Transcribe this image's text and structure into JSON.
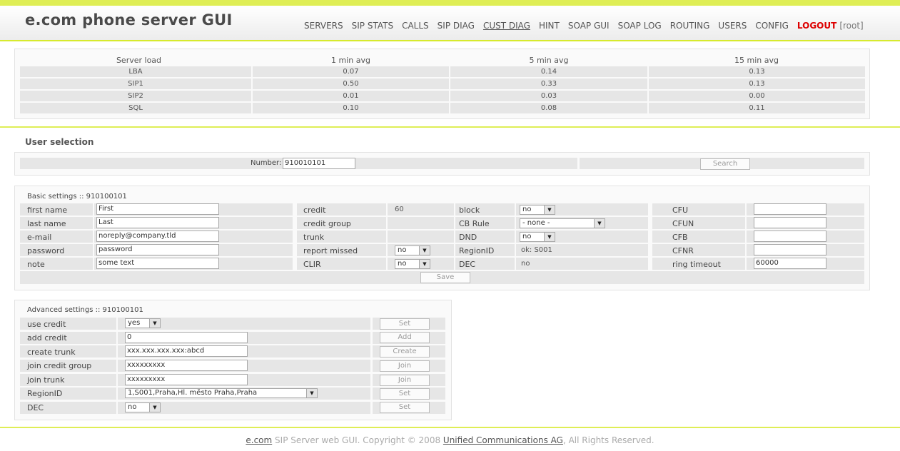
{
  "header": {
    "title": "e.com phone server GUI",
    "nav": [
      "SERVERS",
      "SIP STATS",
      "CALLS",
      "SIP DIAG",
      "CUST DIAG",
      "HINT",
      "SOAP GUI",
      "SOAP LOG",
      "ROUTING",
      "USERS",
      "CONFIG"
    ],
    "logout": "LOGOUT",
    "user": "[root]"
  },
  "load": {
    "headers": [
      "Server load",
      "1 min avg",
      "5 min avg",
      "15 min avg"
    ],
    "rows": [
      [
        "LBA",
        "0.07",
        "0.14",
        "0.13"
      ],
      [
        "SIP1",
        "0.50",
        "0.33",
        "0.13"
      ],
      [
        "SIP2",
        "0.01",
        "0.03",
        "0.00"
      ],
      [
        "SQL",
        "0.10",
        "0.08",
        "0.11"
      ]
    ]
  },
  "selection": {
    "title": "User selection",
    "number_label": "Number:",
    "number_value": "910010101",
    "search": "Search"
  },
  "basic": {
    "title": "Basic settings :: 910100101",
    "col1": [
      {
        "label": "first name",
        "value": "First"
      },
      {
        "label": "last name",
        "value": "Last"
      },
      {
        "label": "e-mail",
        "value": "noreply@company.tld"
      },
      {
        "label": "password",
        "value": "password"
      },
      {
        "label": "note",
        "value": "some text"
      }
    ],
    "col2": [
      {
        "label": "credit",
        "value": "60"
      },
      {
        "label": "credit group",
        "value": ""
      },
      {
        "label": "trunk",
        "value": ""
      },
      {
        "label": "report missed",
        "value": "no"
      },
      {
        "label": "CLIR",
        "value": "no"
      }
    ],
    "col3": [
      {
        "label": "block",
        "value": "no"
      },
      {
        "label": "CB Rule",
        "value": "- none -"
      },
      {
        "label": "DND",
        "value": "no"
      },
      {
        "label": "RegionID",
        "value": "ok: S001"
      },
      {
        "label": "DEC",
        "value": "no"
      }
    ],
    "col4": [
      {
        "label": "CFU",
        "value": ""
      },
      {
        "label": "CFUN",
        "value": ""
      },
      {
        "label": "CFB",
        "value": ""
      },
      {
        "label": "CFNR",
        "value": ""
      },
      {
        "label": "ring timeout",
        "value": "60000"
      }
    ],
    "save": "Save"
  },
  "advanced": {
    "title": "Advanced settings :: 910100101",
    "rows": [
      {
        "label": "use credit",
        "value": "yes",
        "button": "Set"
      },
      {
        "label": "add credit",
        "value": "0",
        "button": "Add"
      },
      {
        "label": "create trunk",
        "value": "xxx.xxx.xxx.xxx:abcd",
        "button": "Create"
      },
      {
        "label": "join credit group",
        "value": "xxxxxxxxx",
        "button": "Join"
      },
      {
        "label": "join trunk",
        "value": "xxxxxxxxx",
        "button": "Join"
      },
      {
        "label": "RegionID",
        "value": "1,S001,Praha,Hl. město Praha,Praha",
        "button": "Set"
      },
      {
        "label": "DEC",
        "value": "no",
        "button": "Set"
      }
    ]
  },
  "footer": {
    "brand": "e.com",
    "text": " SIP Server web GUI. Copyright © 2008 ",
    "company": "Unified Communications AG",
    "rights": ", All Rights Reserved."
  },
  "colors": {
    "accent": "#dfee56",
    "logout": "#dd0000",
    "row": "#e6e6e6"
  }
}
